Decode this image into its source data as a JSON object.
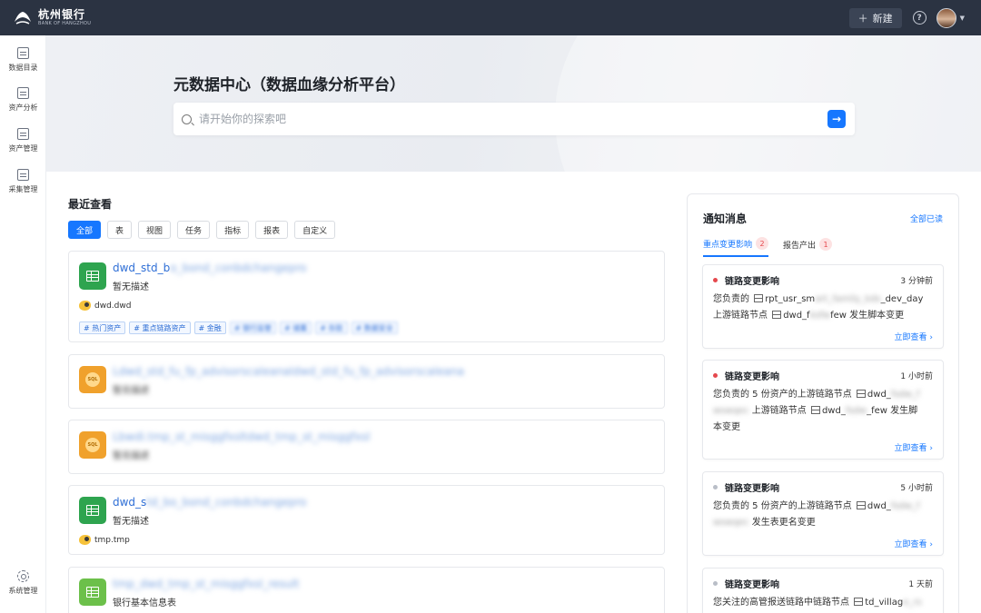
{
  "topbar": {
    "brand_cn": "杭州银行",
    "brand_en": "BANK OF HANGZHOU",
    "new_button": "新建",
    "new_icon": "plus-icon",
    "help_icon": "help-icon"
  },
  "sidenav": {
    "items": [
      {
        "label": "数据目录",
        "icon": "catalog-icon"
      },
      {
        "label": "资产分析",
        "icon": "analysis-icon"
      },
      {
        "label": "资产管理",
        "icon": "asset-icon"
      },
      {
        "label": "采集管理",
        "icon": "collect-icon"
      }
    ],
    "bottom_item": {
      "label": "系统管理",
      "icon": "gear-icon"
    }
  },
  "hero": {
    "title": "元数据中心（数据血缘分析平台）",
    "search_placeholder": "请开始你的探索吧",
    "search_value": ""
  },
  "recent": {
    "title": "最近查看",
    "filters": [
      "全部",
      "表",
      "视图",
      "任务",
      "指标",
      "报表",
      "自定义"
    ],
    "active_filter": "全部",
    "cards": [
      {
        "icon": "table-icon",
        "name_visible": "dwd_std_b",
        "name_blurred": "o_bond_conbdchangepro",
        "desc": "暂无描述",
        "db": "dwd.dwd",
        "tags": [
          "# 热门资产",
          "# 重点链路资产",
          "# 金融"
        ],
        "blurred_tags": [
          "# 银行监管",
          "# 储蓄",
          "# 存款",
          "# 数据安全"
        ]
      },
      {
        "icon": "sql-icon",
        "name_visible": "",
        "name_blurred": "Ldwd_std_fu_fp_advisorscaleanaldwd_std_fu_fp_advisorscaleana",
        "desc": "",
        "desc_blurred": "暂无描述",
        "db": "",
        "tags": []
      },
      {
        "icon": "sql-icon",
        "name_visible": "",
        "name_blurred": "Lbwdi.tmp_st_misggfxsltdwd_tmp_st_misggfxsl",
        "desc": "",
        "desc_blurred": "暂无描述",
        "db": "",
        "tags": []
      },
      {
        "icon": "table-icon",
        "name_visible": "dwd_s",
        "name_blurred": "td_bo_bond_conbdchangepro",
        "desc": "暂无描述",
        "db": "tmp.tmp",
        "tags": []
      },
      {
        "icon": "table-icon",
        "name_visible": "",
        "name_blurred": "tmp_dwd_tmp_st_misggfxsl_result",
        "desc": "银行基本信息表",
        "db": "",
        "tags": []
      }
    ]
  },
  "notifications": {
    "title": "通知消息",
    "read_all": "全部已读",
    "tabs": [
      {
        "label": "重点变更影响",
        "count": "2"
      },
      {
        "label": "报告产出",
        "count": "1"
      }
    ],
    "items": [
      {
        "status": "unread",
        "title": "链路变更影响",
        "time": "3 分钟前",
        "line1_pre": "您负责的",
        "line1_a": "rpt_usr_sm",
        "line1_blur": "art_family_kds",
        "line1_b": "_dev_day",
        "line2_pre": "上游链路节点",
        "line2_a": "dwd_f",
        "line2_blur": "ksfw",
        "line2_b": "few 发生脚本变更",
        "link": "立即查看 ›"
      },
      {
        "status": "unread",
        "title": "链路变更影响",
        "time": "1 小时前",
        "line1_pre": "您负责的 5 份资产的上游链路节点",
        "line1_a": "dwd_",
        "line1_blur": "fsdw_f",
        "line2_blur": "wswqec",
        "line2_pre": "上游链路节点",
        "line2_a": "dwd_",
        "line2_blur2": "fsdw",
        "line2_b": "_few 发生脚",
        "line3": "本变更",
        "link": "立即查看 ›"
      },
      {
        "status": "read",
        "title": "链路变更影响",
        "time": "5 小时前",
        "line1_pre": "您负责的 5 份资产的上游链路节点",
        "line1_a": "dwd_",
        "line1_blur": "fsdw_f",
        "line2_blur": "wswqec",
        "line2_b": "发生表更名变更",
        "link": "立即查看 ›"
      },
      {
        "status": "read",
        "title": "链路变更影响",
        "time": "1 天前",
        "line1_pre": "您关注的高管报送链路中链路节点",
        "line1_a": "td_villag",
        "line1_blur": "e_rs"
      }
    ]
  }
}
